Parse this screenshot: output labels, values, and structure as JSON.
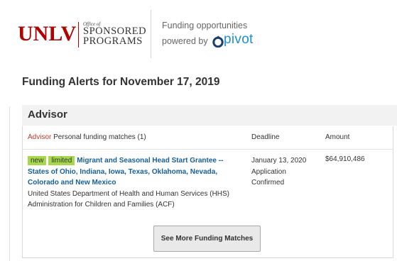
{
  "header": {
    "logo": {
      "wordmark": "UNLV",
      "office_of": "Office of",
      "line1": "SPONSORED",
      "line2": "PROGRAMS"
    },
    "powered": {
      "line1": "Funding opportunities",
      "line2": "powered by",
      "brand": "pivot"
    }
  },
  "alerts": {
    "title": "Funding Alerts for November 17, 2019"
  },
  "advisor": {
    "section_title": "Advisor",
    "columns": {
      "matches_keyword": "Advisor",
      "matches_text": " Personal funding matches (1)",
      "deadline": "Deadline",
      "amount": "Amount"
    },
    "items": [
      {
        "badges": [
          "new",
          "limited"
        ],
        "title": "Migrant and Seasonal Head Start Grantee -- States of Ohio, Indiana, Iowa, Texas, Oklahoma, Nevada, Colorado and New Mexico",
        "sponsor_line1": "United States Department of Health and Human Services (HHS)",
        "sponsor_line2": "Administration for Children and Families (ACF)",
        "deadline_date": "January 13, 2020",
        "deadline_type1": "Application",
        "deadline_type2": "Confirmed",
        "amount": "$64,910,486"
      }
    ],
    "more_button": "See More Funding Matches"
  },
  "colors": {
    "unlv_red": "#b10202",
    "pivot_blue": "#1a8fd6",
    "link_blue": "#16609a",
    "badge_green": "#a7d84c",
    "advisor_keyword": "#c0392b"
  },
  "icons": {
    "pivot_mark": "pivot-logo-icon"
  }
}
